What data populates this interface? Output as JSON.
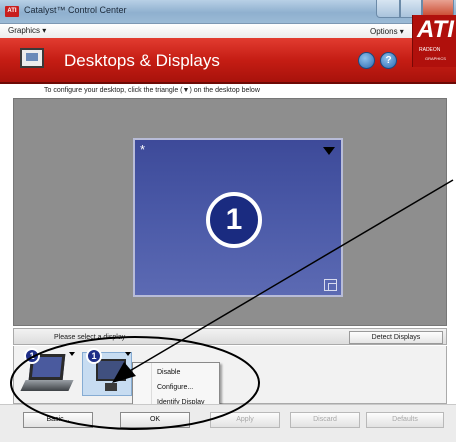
{
  "window": {
    "app_icon_text": "ATI",
    "title": "Catalyst™ Control Center",
    "controls": [
      "minimize-icon",
      "maximize-icon",
      "close-icon"
    ]
  },
  "menubar": {
    "graphics": "Graphics ▾",
    "options": "Options ▾"
  },
  "header": {
    "title": "Desktops & Displays",
    "help_glyph": "?",
    "logo_text": "ATI",
    "logo_sub1": "RADEON",
    "logo_sub2": "GRAPHICS"
  },
  "instruction": "To configure your desktop, click the triangle (▼) on the desktop below",
  "desktop": {
    "primary_marker": "*",
    "display_number": "1"
  },
  "select_bar": {
    "label": "Please select a display",
    "detect_button": "Detect Displays"
  },
  "thumbnails": [
    {
      "number": "1",
      "type": "laptop"
    },
    {
      "number": "1",
      "type": "monitor"
    }
  ],
  "context_menu": {
    "items": [
      "Disable",
      "Configure...",
      "Identify Display"
    ]
  },
  "footer": {
    "basic": "Basic...",
    "ok": "OK",
    "apply": "Apply",
    "discard": "Discard",
    "defaults": "Defaults"
  },
  "colors": {
    "header_red": "#c51d14",
    "desktop_blue": "#4b5aa8",
    "annotation": "#000000"
  }
}
